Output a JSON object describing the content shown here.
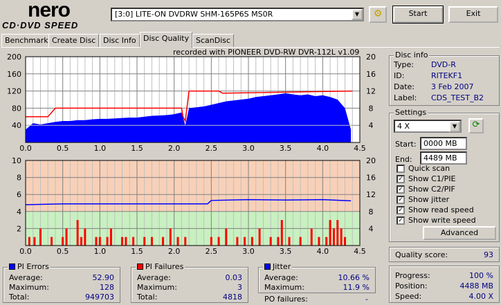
{
  "app": {
    "logo_top": "nero",
    "logo_bottom": "CD·DVD SPEED"
  },
  "toolbar": {
    "drive": "[3:0]  LITE-ON DVDRW SHM-165P6S MS0R",
    "start": "Start",
    "exit": "Exit"
  },
  "tabs": [
    {
      "label": "Benchmark"
    },
    {
      "label": "Create Disc"
    },
    {
      "label": "Disc Info"
    },
    {
      "label": "Disc Quality",
      "active": true
    },
    {
      "label": "ScanDisc"
    }
  ],
  "chart_data": [
    {
      "type": "area",
      "title": "recorded with PIONEER DVD-RW  DVR-112L v1.09",
      "xlim": [
        0,
        4.5
      ],
      "ylim_left": [
        0,
        200
      ],
      "ylim_right": [
        0,
        20
      ],
      "x_ticks": [
        "0.0",
        "0.5",
        "1.0",
        "1.5",
        "2.0",
        "2.5",
        "3.0",
        "3.5",
        "4.0",
        "4.5"
      ],
      "y_ticks_left": [
        "40",
        "80",
        "120",
        "160",
        "200"
      ],
      "y_ticks_right": [
        "4",
        "8",
        "12",
        "16",
        "20"
      ],
      "series": [
        {
          "name": "PI Errors",
          "color": "#0000ff",
          "x": [
            0,
            0.1,
            0.2,
            0.3,
            0.4,
            0.5,
            0.6,
            0.7,
            0.8,
            0.9,
            1.0,
            1.1,
            1.2,
            1.3,
            1.4,
            1.5,
            1.6,
            1.7,
            1.8,
            1.9,
            2.0,
            2.1,
            2.15,
            2.2,
            2.3,
            2.4,
            2.5,
            2.6,
            2.7,
            2.8,
            2.9,
            3.0,
            3.1,
            3.2,
            3.3,
            3.4,
            3.5,
            3.6,
            3.7,
            3.8,
            3.9,
            4.0,
            4.1,
            4.2,
            4.3,
            4.38
          ],
          "values": [
            30,
            45,
            42,
            45,
            48,
            50,
            50,
            52,
            52,
            54,
            55,
            55,
            56,
            57,
            58,
            58,
            60,
            62,
            63,
            64,
            66,
            70,
            40,
            80,
            82,
            84,
            88,
            92,
            96,
            98,
            100,
            102,
            106,
            108,
            110,
            112,
            115,
            112,
            110,
            112,
            108,
            110,
            106,
            100,
            80,
            30
          ]
        },
        {
          "name": "Read speed",
          "color": "#ff0000",
          "axis": "right",
          "x": [
            0,
            0.3,
            0.35,
            0.4,
            2.1,
            2.12,
            2.15,
            2.2,
            2.6,
            2.65,
            4.4
          ],
          "values": [
            6,
            6,
            7,
            8,
            8,
            6,
            5,
            12,
            12,
            11.5,
            12
          ]
        },
        {
          "name": "Write speed",
          "color": "#c0c0c0",
          "axis": "right",
          "x": [
            0,
            4.4
          ],
          "values": [
            4,
            4
          ]
        }
      ]
    },
    {
      "type": "bar",
      "xlim": [
        0,
        4.5
      ],
      "ylim_left": [
        0,
        10
      ],
      "ylim_right": [
        0,
        20
      ],
      "x_ticks": [
        "0.0",
        "0.5",
        "1.0",
        "1.5",
        "2.0",
        "2.5",
        "3.0",
        "3.5",
        "4.0",
        "4.5"
      ],
      "y_ticks_left": [
        "2",
        "4",
        "6",
        "8",
        "10"
      ],
      "y_ticks_right": [
        "4",
        "8",
        "12",
        "16",
        "20"
      ],
      "series": [
        {
          "name": "PI Failures",
          "color": "#ff0000",
          "x": [
            0.05,
            0.12,
            0.2,
            0.35,
            0.5,
            0.55,
            0.7,
            0.75,
            0.8,
            0.95,
            1.0,
            1.1,
            1.15,
            1.3,
            1.35,
            1.45,
            1.6,
            1.7,
            1.85,
            1.95,
            2.05,
            2.15,
            2.5,
            2.6,
            2.7,
            2.85,
            2.95,
            3.05,
            3.15,
            3.3,
            3.4,
            3.45,
            3.55,
            3.7,
            3.85,
            3.95,
            4.05,
            4.1,
            4.15,
            4.2,
            4.25,
            4.3
          ],
          "values": [
            1,
            1,
            2,
            1,
            1,
            2,
            3,
            1,
            2,
            1,
            1,
            1,
            2,
            1,
            1,
            1,
            1,
            1,
            1,
            2,
            1,
            1,
            1,
            1,
            2,
            1,
            1,
            1,
            2,
            1,
            1,
            3,
            1,
            1,
            2,
            1,
            1,
            3,
            2,
            3,
            2,
            1
          ]
        },
        {
          "name": "Jitter",
          "color": "#0000ff",
          "axis": "right",
          "x": [
            0,
            0.5,
            1,
            1.5,
            2,
            2.45,
            2.5,
            3,
            3.5,
            4,
            4.38
          ],
          "values": [
            9.6,
            9.8,
            9.8,
            9.8,
            9.8,
            9.8,
            10.6,
            10.8,
            10.7,
            10.8,
            10.5
          ]
        }
      ]
    }
  ],
  "disc_info": {
    "title": "Disc info",
    "type_label": "Type:",
    "type": "DVD-R",
    "id_label": "ID:",
    "id": "RITEKF1",
    "date_label": "Date:",
    "date": "3 Feb 2007",
    "label_label": "Label:",
    "label": "CDS_TEST_B2"
  },
  "settings": {
    "title": "Settings",
    "speed": "4 X",
    "start_label": "Start:",
    "start": "0000 MB",
    "end_label": "End:",
    "end": "4489 MB",
    "checks": [
      {
        "label": "Quick scan",
        "checked": false
      },
      {
        "label": "Show C1/PIE",
        "checked": true
      },
      {
        "label": "Show C2/PIF",
        "checked": true
      },
      {
        "label": "Show jitter",
        "checked": true
      },
      {
        "label": "Show read speed",
        "checked": true
      },
      {
        "label": "Show write speed",
        "checked": true
      }
    ],
    "advanced": "Advanced"
  },
  "quality": {
    "label": "Quality score:",
    "value": "93"
  },
  "pi_errors": {
    "title": "PI Errors",
    "color": "#0000ff",
    "avg_label": "Average:",
    "avg": "52.90",
    "max_label": "Maximum:",
    "max": "128",
    "total_label": "Total:",
    "total": "949703"
  },
  "pi_failures": {
    "title": "PI Failures",
    "color": "#ff0000",
    "avg_label": "Average:",
    "avg": "0.03",
    "max_label": "Maximum:",
    "max": "3",
    "total_label": "Total:",
    "total": "4818"
  },
  "jitter": {
    "title": "Jitter",
    "color": "#0000ff",
    "avg_label": "Average:",
    "avg": "10.66 %",
    "max_label": "Maximum:",
    "max": "11.9 %",
    "po_label": "PO failures:",
    "po": "-"
  },
  "progress": {
    "progress_label": "Progress:",
    "progress": "100 %",
    "position_label": "Position:",
    "position": "4488 MB",
    "speed_label": "Speed:",
    "speed": "4.00 X"
  }
}
